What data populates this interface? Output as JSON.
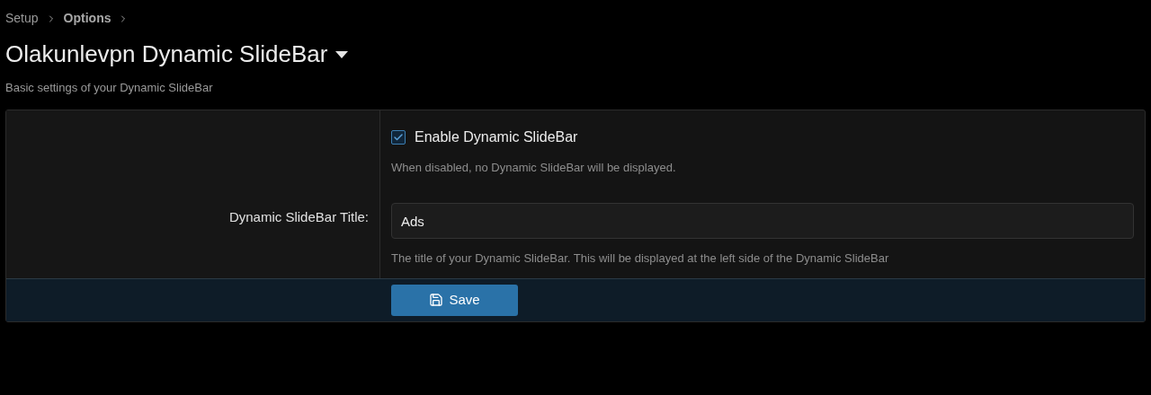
{
  "breadcrumbs": [
    {
      "label": "Setup",
      "selected": false
    },
    {
      "label": "Options",
      "selected": true
    }
  ],
  "page": {
    "title": "Olakunlevpn Dynamic SlideBar",
    "description": "Basic settings of your Dynamic SlideBar"
  },
  "options": [
    {
      "kind": "checkbox",
      "label": "Enable Dynamic SlideBar",
      "checked": true,
      "hint": "When disabled, no Dynamic SlideBar will be displayed."
    },
    {
      "kind": "text",
      "label": "Dynamic SlideBar Title:",
      "value": "Ads",
      "hint": "The title of your Dynamic SlideBar. This will be displayed at the left side of the Dynamic SlideBar"
    }
  ],
  "buttons": [
    {
      "label": "Save"
    }
  ]
}
